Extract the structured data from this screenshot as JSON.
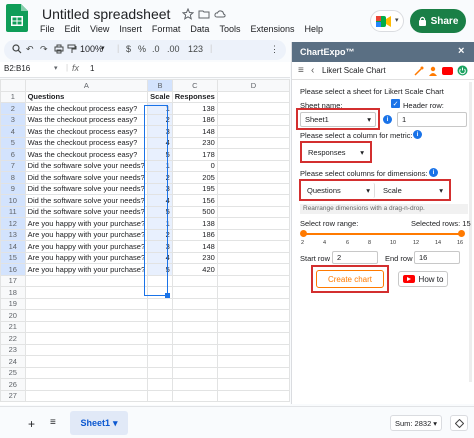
{
  "app": {
    "title": "Untitled spreadsheet",
    "menu": [
      "File",
      "Edit",
      "View",
      "Insert",
      "Format",
      "Data",
      "Tools",
      "Extensions",
      "Help"
    ],
    "share_label": "Share"
  },
  "toolbar": {
    "zoom": "100%"
  },
  "formula_bar": {
    "name_box": "B2:B16",
    "fx": "fx",
    "value": "1"
  },
  "sheet": {
    "columns": [
      "A",
      "B",
      "C",
      "D"
    ],
    "header_row": [
      "Questions",
      "Scale",
      "Responses",
      ""
    ],
    "rows": [
      [
        "Was the checkout process easy?",
        "1",
        "138"
      ],
      [
        "Was the checkout process easy?",
        "2",
        "186"
      ],
      [
        "Was the checkout process easy?",
        "3",
        "148"
      ],
      [
        "Was the checkout process easy?",
        "4",
        "230"
      ],
      [
        "Was the checkout process easy?",
        "5",
        "178"
      ],
      [
        "Did the software solve your needs?",
        "1",
        "0"
      ],
      [
        "Did the software solve your needs?",
        "2",
        "205"
      ],
      [
        "Did the software solve your needs?",
        "3",
        "195"
      ],
      [
        "Did the software solve your needs?",
        "4",
        "156"
      ],
      [
        "Did the software solve your needs?",
        "5",
        "500"
      ],
      [
        "Are you happy with your purchase?",
        "1",
        "138"
      ],
      [
        "Are you happy with your purchase?",
        "2",
        "186"
      ],
      [
        "Are you happy with your purchase?",
        "3",
        "148"
      ],
      [
        "Are you happy with your purchase?",
        "4",
        "230"
      ],
      [
        "Are you happy with your purchase?",
        "5",
        "420"
      ]
    ],
    "extra_row_numbers": [
      "17",
      "18",
      "19",
      "20",
      "21",
      "22",
      "23",
      "24",
      "25",
      "26",
      "27"
    ],
    "tab_name": "Sheet1",
    "sum": "Sum: 2832"
  },
  "panel": {
    "header_title": "ChartExpo™",
    "close": "×",
    "nav_label": "Likert Scale Chart",
    "select_sheet_label": "Please select a sheet for Likert Scale Chart",
    "sheet_name_label": "Sheet name:",
    "header_row_label": "Header row:",
    "sheet_name_value": "Sheet1",
    "header_row_value": "1",
    "metric_label": "Please select a column for metric:",
    "metric_value": "Responses",
    "dimensions_label": "Please select columns for dimensions:",
    "dimension_1": "Questions",
    "dimension_2": "Scale",
    "rearrange_hint": "Rearrange dimensions with a drag-n-drop.",
    "row_range_label": "Select row range:",
    "selected_rows_label": "Selected rows: 15",
    "ticks": [
      "2",
      "4",
      "6",
      "8",
      "10",
      "12",
      "14",
      "16"
    ],
    "start_row_label": "Start row",
    "start_row_value": "2",
    "end_row_label": "End row",
    "end_row_value": "16",
    "create_chart": "Create chart",
    "how_to": "How to",
    "info": "i",
    "header_row_checked": true
  },
  "colors": {
    "accent": "#ff7a00",
    "share": "#1a7f46",
    "panel_header": "#5a6f83",
    "highlight": "#d32f2f"
  }
}
